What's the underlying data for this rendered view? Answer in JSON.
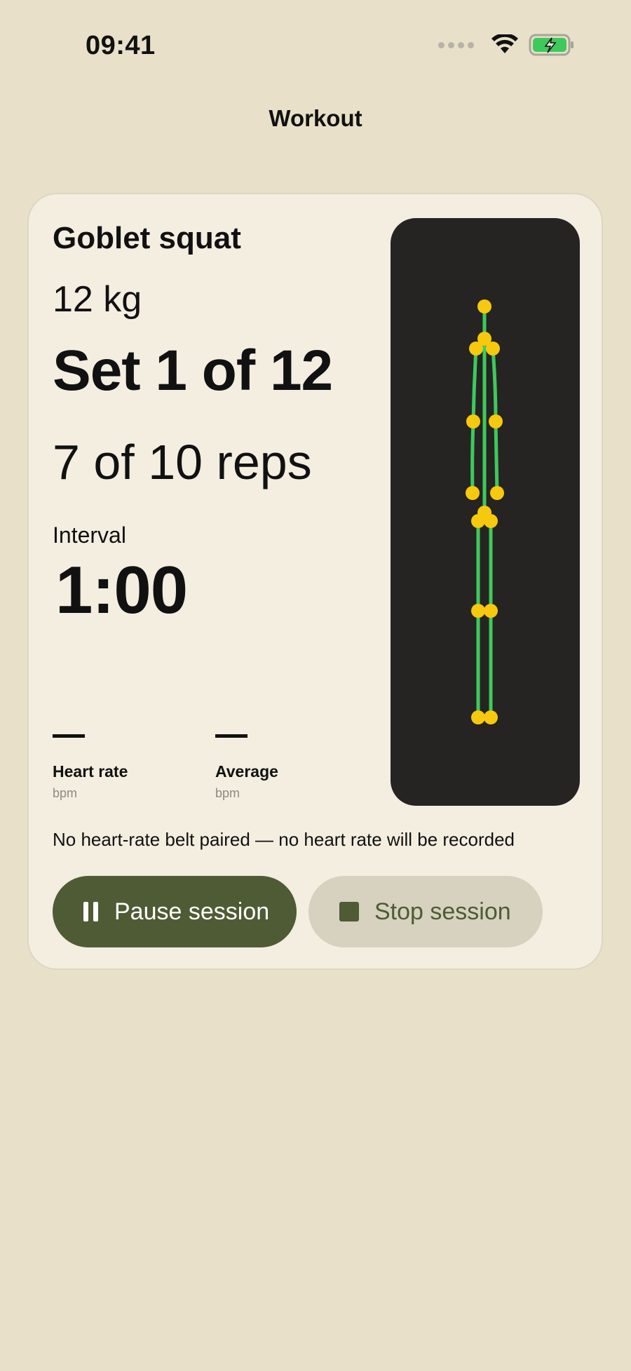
{
  "status_bar": {
    "time": "09:41",
    "signal_icon": "signal-dots-icon",
    "wifi_icon": "wifi-icon",
    "battery_icon": "battery-charging-icon"
  },
  "nav": {
    "title": "Workout"
  },
  "exercise": {
    "name": "Goblet squat",
    "weight": "12 kg",
    "set_text": "Set 1 of 12",
    "reps_text": "7 of 10 reps",
    "interval_label": "Interval",
    "interval_value": "1:00"
  },
  "metrics": [
    {
      "value": "—",
      "label": "Heart rate",
      "unit": "bpm"
    },
    {
      "value": "—",
      "label": "Average",
      "unit": "bpm"
    }
  ],
  "notice": "No heart-rate belt paired — no heart rate will be recorded",
  "buttons": {
    "pause_label": "Pause session",
    "pause_icon": "pause-icon",
    "stop_label": "Stop session",
    "stop_icon": "stop-icon"
  },
  "colors": {
    "background": "#e8e0c8",
    "card": "#f3eee0",
    "accent": "#4e5b34",
    "skeleton_bone": "#3ec95c",
    "skeleton_joint": "#f6c90e",
    "skeleton_panel": "#252422"
  }
}
